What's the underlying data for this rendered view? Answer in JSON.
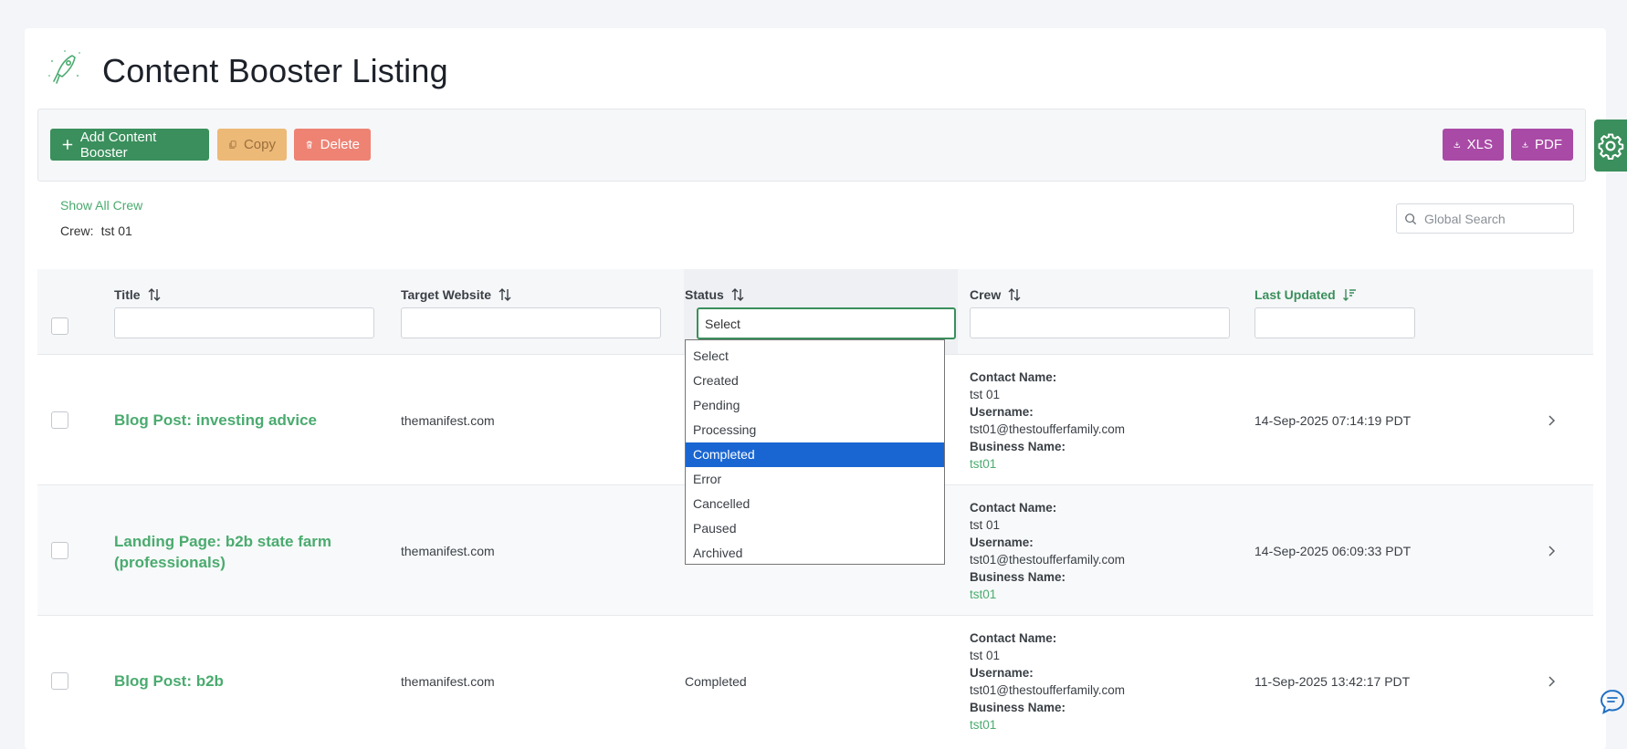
{
  "page": {
    "title": "Content Booster Listing"
  },
  "toolbar": {
    "add_label": "Add Content Booster",
    "copy_label": "Copy",
    "delete_label": "Delete",
    "xls_label": "XLS",
    "pdf_label": "PDF"
  },
  "filters": {
    "show_all_label": "Show All Crew",
    "crew_label": "Crew:",
    "crew_value": "tst 01"
  },
  "search": {
    "placeholder": "Global Search"
  },
  "table": {
    "columns": {
      "title": "Title",
      "target": "Target Website",
      "status": "Status",
      "crew": "Crew",
      "updated": "Last Updated"
    },
    "status_filter_value": "Select",
    "rows": [
      {
        "title": "Blog Post: investing advice",
        "site": "themanifest.com",
        "status": "",
        "contact_label": "Contact Name:",
        "contact": "tst 01",
        "username_label": "Username:",
        "username": "tst01@thestoufferfamily.com",
        "business_label": "Business Name:",
        "business": "tst01",
        "updated": "14-Sep-2025 07:14:19 PDT"
      },
      {
        "title": "Landing Page: b2b state farm (professionals)",
        "site": "themanifest.com",
        "status": "",
        "contact_label": "Contact Name:",
        "contact": "tst 01",
        "username_label": "Username:",
        "username": "tst01@thestoufferfamily.com",
        "business_label": "Business Name:",
        "business": "tst01",
        "updated": "14-Sep-2025 06:09:33 PDT"
      },
      {
        "title": "Blog Post: b2b",
        "site": "themanifest.com",
        "status": "Completed",
        "contact_label": "Contact Name:",
        "contact": "tst 01",
        "username_label": "Username:",
        "username": "tst01@thestoufferfamily.com",
        "business_label": "Business Name:",
        "business": "tst01",
        "updated": "11-Sep-2025 13:42:17 PDT"
      }
    ]
  },
  "status_dropdown": {
    "options": [
      "Select",
      "Created",
      "Pending",
      "Processing",
      "Completed",
      "Error",
      "Cancelled",
      "Paused",
      "Archived"
    ],
    "highlighted": "Completed"
  },
  "colors": {
    "brand_green": "#3a8f5c",
    "link_green": "#4aab6f",
    "copy_orange": "#edb977",
    "delete_red": "#ee8273",
    "export_purple": "#a94aa6",
    "selection_blue": "#1966d2"
  }
}
